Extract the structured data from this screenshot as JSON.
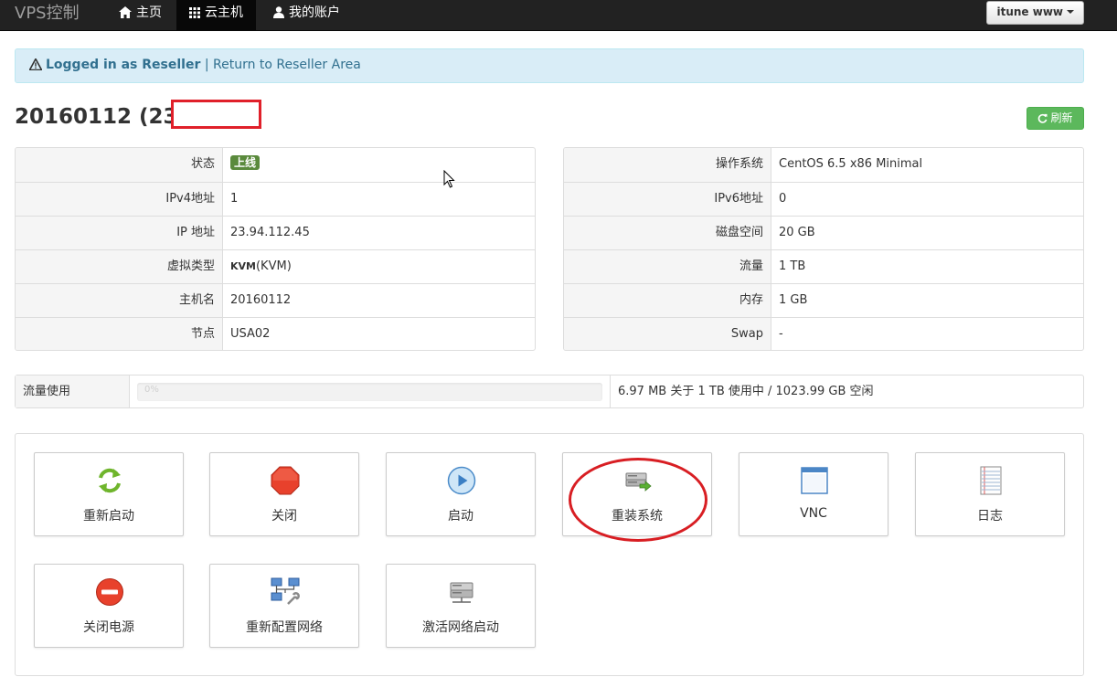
{
  "navbar": {
    "brand": "VPS控制",
    "items": [
      {
        "label": "主页",
        "icon": "home-icon"
      },
      {
        "label": "云主机",
        "icon": "grid-icon"
      },
      {
        "label": "我的账户",
        "icon": "user-icon"
      }
    ],
    "user_menu": "itune www"
  },
  "alert": {
    "bold": "Logged in as Reseller",
    "separator": " | ",
    "link": "Return to Reseller Area"
  },
  "title": "20160112 (23.9",
  "refresh_label": "刷新",
  "left_table": [
    {
      "label": "状态",
      "value": "上线",
      "badge": true
    },
    {
      "label": "IPv4地址",
      "value": "1"
    },
    {
      "label": "IP 地址",
      "value": "23.94.112.45"
    },
    {
      "label": "虚拟类型",
      "value": "(KVM)",
      "logo": "KVM"
    },
    {
      "label": "主机名",
      "value": "20160112"
    },
    {
      "label": "节点",
      "value": "USA02"
    }
  ],
  "right_table": [
    {
      "label": "操作系统",
      "value": "CentOS 6.5 x86 Minimal"
    },
    {
      "label": "IPv6地址",
      "value": "0"
    },
    {
      "label": "磁盘空间",
      "value": "20 GB"
    },
    {
      "label": "流量",
      "value": "1 TB"
    },
    {
      "label": "内存",
      "value": "1 GB"
    },
    {
      "label": "Swap",
      "value": "-"
    }
  ],
  "traffic": {
    "label": "流量使用",
    "percent_text": "0%",
    "percent": 0,
    "text": "6.97 MB 关于 1 TB 使用中 / 1023.99 GB 空闲"
  },
  "actions": [
    {
      "label": "重新启动",
      "icon": "reboot-icon"
    },
    {
      "label": "关闭",
      "icon": "stop-icon"
    },
    {
      "label": "启动",
      "icon": "play-icon"
    },
    {
      "label": "重装系统",
      "icon": "reinstall-icon"
    },
    {
      "label": "VNC",
      "icon": "window-icon"
    },
    {
      "label": "日志",
      "icon": "log-icon"
    },
    {
      "label": "关闭电源",
      "icon": "power-off-icon"
    },
    {
      "label": "重新配置网络",
      "icon": "network-icon"
    },
    {
      "label": "激活网络启动",
      "icon": "netboot-icon"
    }
  ],
  "colors": {
    "navbar": "#222222",
    "alert_bg": "#d9edf7",
    "success": "#5cb85c",
    "highlight": "#d81e23"
  }
}
